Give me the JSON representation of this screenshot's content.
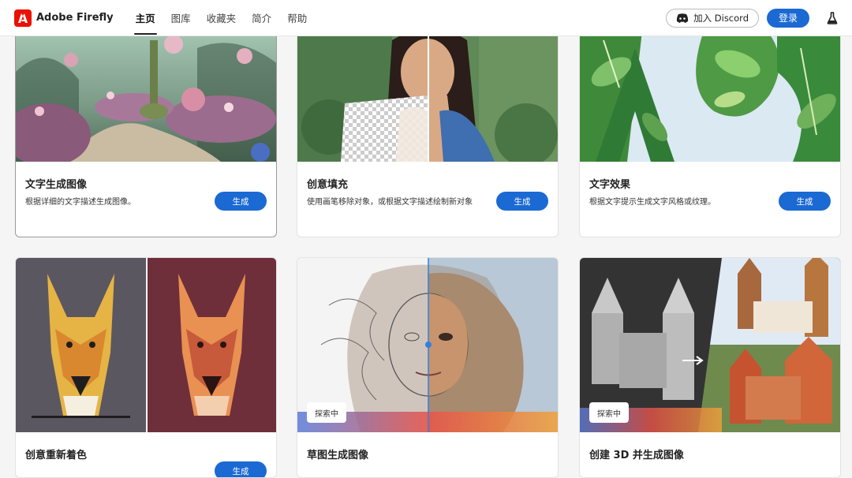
{
  "header": {
    "brand": "Adobe Firefly",
    "nav": [
      "主页",
      "图库",
      "收藏夹",
      "简介",
      "帮助"
    ],
    "discord_label": "加入 Discord",
    "login_label": "登录"
  },
  "cards": [
    {
      "title": "文字生成图像",
      "desc": "根据详细的文字描述生成图像。",
      "button": "生成"
    },
    {
      "title": "创意填充",
      "desc": "使用画笔移除对象，或根据文字描述绘制新对象",
      "button": "生成"
    },
    {
      "title": "文字效果",
      "desc": "根据文字提示生成文字风格或纹理。",
      "button": "生成"
    },
    {
      "title": "创意重新着色",
      "button": "生成"
    },
    {
      "title": "草图生成图像",
      "badge": "探索中"
    },
    {
      "title": "创建 3D 并生成图像",
      "badge": "探索中"
    }
  ],
  "colors": {
    "accent": "#1b69d3",
    "brand": "#eb1000"
  }
}
